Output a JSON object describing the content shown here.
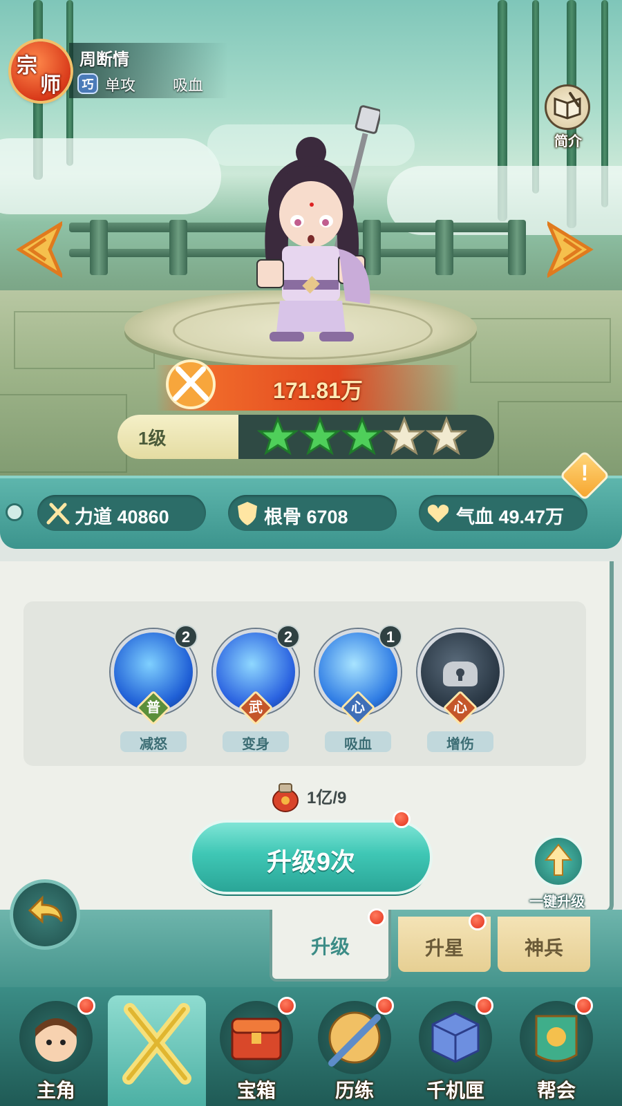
{
  "header": {
    "rank_char_1": "宗",
    "rank_char_2": "师",
    "hero_name": "周断情",
    "type_chip": "巧",
    "tag_attack": "单攻",
    "tag_effect": "吸血",
    "intro_label": "简介"
  },
  "hero": {
    "power": "171.81万",
    "level": "1级",
    "stars_filled": 3,
    "stars_total": 5
  },
  "stats": {
    "strength": "力道 40860",
    "constitution": "根骨 6708",
    "vitality": "气血 49.47万",
    "warning": "!"
  },
  "skills": [
    {
      "level": "2",
      "kind": "普",
      "name": "减怒",
      "kind_color": "#5a8f3a"
    },
    {
      "level": "2",
      "kind": "武",
      "name": "变身",
      "kind_color": "#c4562a"
    },
    {
      "level": "1",
      "kind": "心",
      "name": "吸血",
      "kind_color": "#3f6fb8"
    },
    {
      "level": "",
      "kind": "心",
      "name": "增伤",
      "kind_color": "#c4562a"
    }
  ],
  "cost": {
    "text": "1亿/9"
  },
  "actions": {
    "upgrade_button": "升级9次",
    "oneclick_label": "一键升级"
  },
  "tabs": [
    {
      "label": "升级"
    },
    {
      "label": "升星"
    },
    {
      "label": "神兵"
    }
  ],
  "bottom_nav": [
    {
      "label": "主角"
    },
    {
      "label": ""
    },
    {
      "label": "宝箱"
    },
    {
      "label": "历练"
    },
    {
      "label": "千机匣"
    },
    {
      "label": "帮会"
    }
  ],
  "colors": {
    "accent": "#3fc7b5",
    "badge": "#e2311b",
    "power_banner": "#e2471f",
    "star_filled": "#4fcf5a",
    "star_empty": "#f1ead0"
  }
}
